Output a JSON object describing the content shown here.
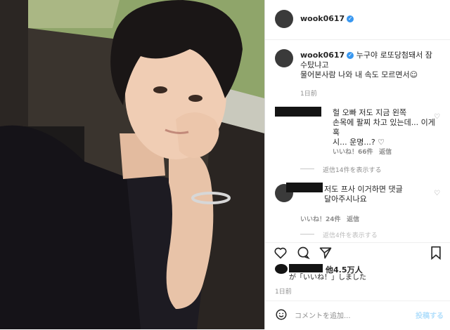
{
  "header": {
    "username": "wook0617"
  },
  "caption": {
    "username": "wook0617",
    "line1": "누구야 로또당첨돼서 잠",
    "line2": "수탔냐고",
    "line3": "물어본사람 나와 내 속도 모르면서☺",
    "time": "1日前"
  },
  "comments": [
    {
      "lines": [
        "헐 오빠 저도 지금 왼쪽",
        "손목에 팔찌 차고 있는데... 이게 혹",
        "시... 운명...? ♡"
      ],
      "likes": "いいね！66件",
      "reply": "返信",
      "view_replies": "返信14件を表示する"
    },
    {
      "lines": [
        "저도 프사 이거하면 댓글",
        "달아주시나요"
      ],
      "likes": "いいね！24件",
      "reply": "返信",
      "view_replies": "返信4件を表示する"
    }
  ],
  "likes_summary": {
    "prefix": "他4.5万人",
    "suffix": "が「いいね！」しました"
  },
  "post_time": "1日前",
  "add_comment": {
    "placeholder": "コメントを追加...",
    "post_label": "投稿する"
  },
  "icons": [
    "verified-badge-icon",
    "heart-icon",
    "comment-icon",
    "share-icon",
    "bookmark-icon",
    "emoji-icon"
  ],
  "colors": {
    "verified": "#3897f0",
    "post_button": "#b2dffc",
    "muted": "#8e8e8e"
  }
}
